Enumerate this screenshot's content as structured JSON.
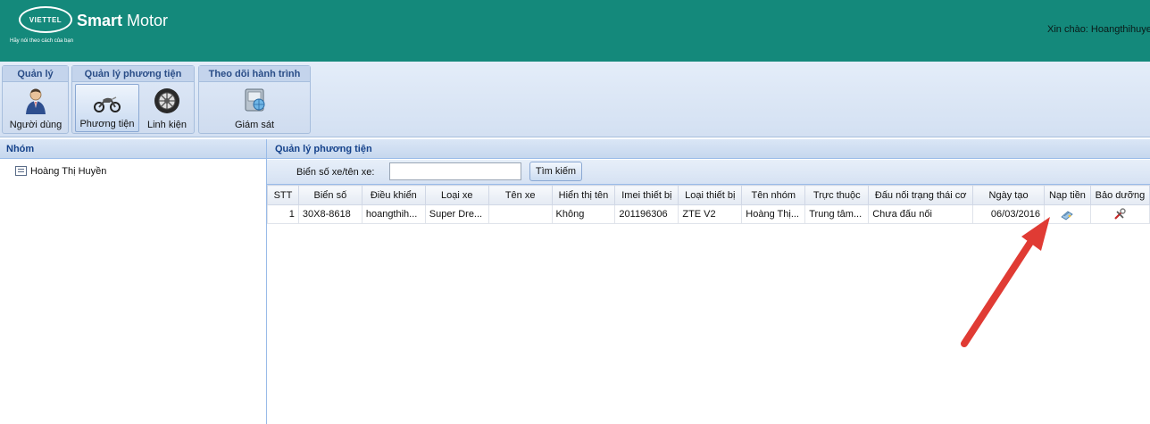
{
  "header": {
    "brand": "VIETTEL",
    "title_bold": "Smart",
    "title_rest": " Motor",
    "slogan": "Hãy nói theo cách của bạn",
    "greeting": "Xin chào: Hoangthihuye"
  },
  "ribbon": {
    "groups": [
      {
        "title": "Quản lý",
        "buttons": [
          {
            "label": "Người dùng",
            "icon": "user-icon"
          }
        ]
      },
      {
        "title": "Quản lý phương tiện",
        "buttons": [
          {
            "label": "Phương tiện",
            "icon": "motorbike-icon",
            "active": true
          },
          {
            "label": "Linh kiện",
            "icon": "tire-icon"
          }
        ]
      },
      {
        "title": "Theo dõi hành trình",
        "buttons": [
          {
            "label": "Giám sát",
            "icon": "monitor-icon"
          }
        ]
      }
    ]
  },
  "left_panel": {
    "title": "Nhóm",
    "tree": [
      {
        "label": "Hoàng Thị Huyền"
      }
    ]
  },
  "main_panel": {
    "title": "Quản lý phương tiện",
    "search_label": "Biển số xe/tên xe:",
    "search_value": "",
    "search_button": "Tìm kiếm",
    "columns": [
      "STT",
      "Biển số",
      "Điều khiển",
      "Loại xe",
      "Tên xe",
      "Hiển thị tên",
      "Imei thiết bị",
      "Loại thiết bị",
      "Tên nhóm",
      "Trực thuộc",
      "Đấu nối trạng thái cơ",
      "Ngày tạo",
      "Nạp tiền",
      "Bảo dưỡng"
    ],
    "rows": [
      {
        "stt": "1",
        "bien_so": "30X8-8618",
        "dieu_khien": "hoangthih...",
        "loai_xe": "Super Dre...",
        "ten_xe": "",
        "hien_thi_ten": "Không",
        "imei": "201196306",
        "loai_thiet_bi": "ZTE V2",
        "ten_nhom": "Hoàng Thị...",
        "truc_thuoc": "Trung tâm...",
        "dau_noi": "Chưa đấu nối",
        "ngay_tao": "06/03/2016",
        "nap_tien_icon": "topup-icon",
        "bao_duong_icon": "maintenance-icon"
      }
    ]
  },
  "annotation": {
    "arrow_color": "#e03b34"
  },
  "colors": {
    "header_bg": "#14897b",
    "panel_title": "#15428b",
    "ribbon_title": "#2a4d87"
  }
}
